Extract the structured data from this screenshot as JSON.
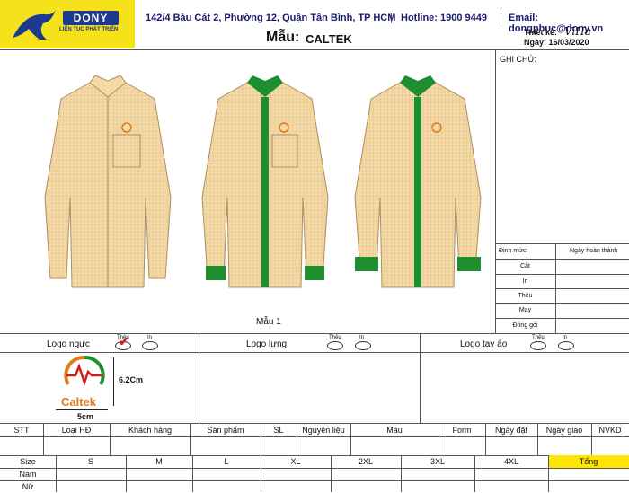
{
  "header": {
    "brand": "DONY",
    "slogan": "LIÊN TỤC PHÁT TRIỂN",
    "address": "142/4 Bàu Cát 2, Phường 12, Quận Tân Bình, TP HCM",
    "hotline": "Hotline: 1900 9449",
    "email": "Email: dongphuc@dony.vn",
    "mau_label": "Mẫu:",
    "mau_value": "CALTEK",
    "thietke_label": "Thiết kế:",
    "thietke_value": "ViHa",
    "ngay": "Ngày: 16/03/2020"
  },
  "design": {
    "caption": "Mẫu 1",
    "ghi_chu": "GHI CHÚ:",
    "dinh_muc": "Định mức:",
    "ngay_hoan_thanh": "Ngày hoàn thành",
    "steps": [
      "Cắt",
      "In",
      "Thêu",
      "May",
      "Đóng gói"
    ]
  },
  "logos": {
    "nguc": "Logo ngực",
    "lung": "Logo lưng",
    "tay_ao": "Logo tay áo",
    "theu": "Thêu",
    "in": "In",
    "height": "6.2Cm",
    "width": "5cm",
    "caltek": "Caltek"
  },
  "order": {
    "headers": [
      "STT",
      "Loại HĐ",
      "Khách hàng",
      "Sản phẩm",
      "SL",
      "Nguyên liệu",
      "Màu",
      "Form",
      "Ngày đặt",
      "Ngày giao",
      "NVKD"
    ]
  },
  "sizes": {
    "size_label": "Size",
    "headers": [
      "S",
      "M",
      "L",
      "XL",
      "2XL",
      "3XL",
      "4XL",
      "Tổng"
    ],
    "rows": [
      "Nam",
      "Nữ"
    ]
  },
  "colors": {
    "yellow": "#f6e21b",
    "green": "#1e8f2e",
    "shirt": "#f2d9a6",
    "total": "#ffe600"
  }
}
